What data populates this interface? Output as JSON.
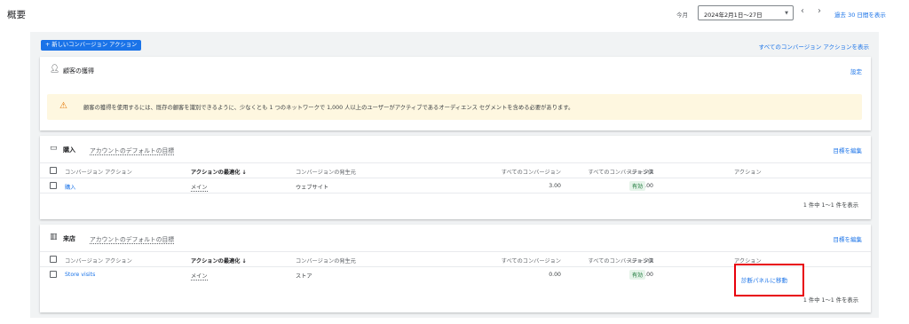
{
  "header": {
    "title": "概要",
    "range_label": "今月",
    "date_range": "2024年2月1日～27日",
    "prev_icon": "chevron-left",
    "next_icon": "chevron-right",
    "last30_label": "過去 30 日間を表示"
  },
  "toolbar": {
    "new_button_label": "+ 新しいコンバージョン アクション",
    "view_all_label": "すべてのコンバージョン アクションを表示"
  },
  "acquisition": {
    "icon": "person-add-icon",
    "title": "顧客の獲得",
    "settings_label": "設定",
    "warning": "顧客の獲得を使用するには、既存の顧客を識別できるように、少なくとも 1 つのネットワークで 1,000 人以上のユーザーがアクティブであるオーディエンス セグメントを含める必要があります。"
  },
  "columns": [
    "コンバージョン アクション",
    "アクションの最適化 ↓",
    "コンバージョンの発生元",
    "すべてのコンバージョン",
    "すべてのコンバージョン値",
    "ステータス",
    "アクション"
  ],
  "purchase": {
    "icon": "credit-card-icon",
    "title": "購入",
    "subtitle": "アカウントのデフォルトの目標",
    "edit_label": "目標を編集",
    "row": {
      "name": "購入",
      "optimization": "メイン",
      "source": "ウェブサイト",
      "all_conversions": "3.00",
      "all_value": "3.00",
      "status": "有効",
      "action": ""
    },
    "footer": "1 件中 1～1 件を表示"
  },
  "store": {
    "icon": "storefront-icon",
    "title": "来店",
    "subtitle": "アカウントのデフォルトの目標",
    "edit_label": "目標を編集",
    "row": {
      "name": "Store visits",
      "optimization": "メイン",
      "source": "ストア",
      "all_conversions": "0.00",
      "all_value": "0.00",
      "status": "有効",
      "action": "診断パネルに移動"
    },
    "footer": "1 件中 1～1 件を表示"
  },
  "colors": {
    "accent": "#1a73e8",
    "highlight_box": "#e8000b",
    "badge_bg": "#e6f4ea",
    "warning_bg": "#fef7e0"
  }
}
